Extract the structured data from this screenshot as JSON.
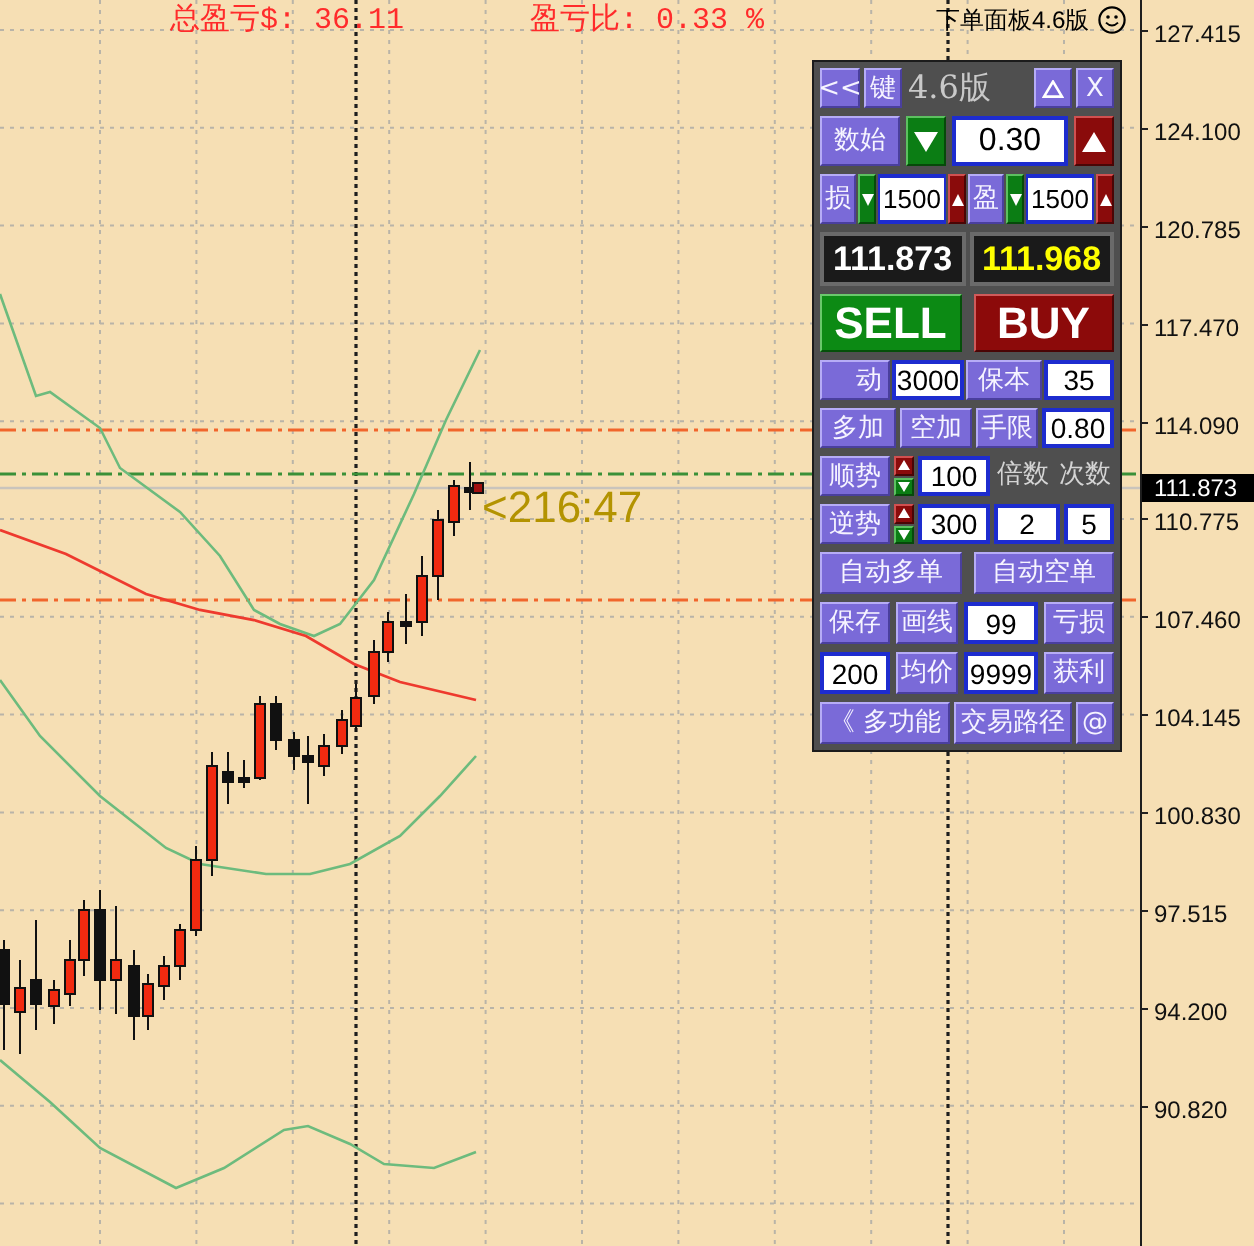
{
  "chart": {
    "stats": [
      "总盈亏$: 36.11",
      "盈亏比: 0.33 %"
    ],
    "caption": "下单面板4.6版",
    "trade_label": "<216:47"
  },
  "price_axis": {
    "ticks": [
      "127.415",
      "124.100",
      "120.785",
      "117.470",
      "114.090",
      "110.775",
      "107.460",
      "104.145",
      "100.830",
      "97.515",
      "94.200",
      "90.820"
    ],
    "current_price": "111.873"
  },
  "panel": {
    "title_bar": [
      {
        "kind": "button",
        "label": "<<"
      },
      {
        "kind": "button",
        "label": "键"
      },
      {
        "kind": "title",
        "text": "4.6版"
      },
      {
        "kind": "minimize"
      },
      {
        "kind": "close",
        "label": "X"
      }
    ],
    "row_1": [
      {
        "kind": "button",
        "label": "数始"
      },
      {
        "kind": "down"
      },
      {
        "kind": "field",
        "value": "0.30"
      },
      {
        "kind": "up"
      }
    ],
    "row_2": [
      {
        "kind": "button",
        "label": "损"
      },
      {
        "kind": "down"
      },
      {
        "kind": "field",
        "value": "1500"
      },
      {
        "kind": "up"
      },
      {
        "kind": "button",
        "label": "盈"
      },
      {
        "kind": "down"
      },
      {
        "kind": "field",
        "value": "1500"
      },
      {
        "kind": "up"
      }
    ],
    "row_3": [
      {
        "kind": "bid",
        "text": "111.873"
      },
      {
        "kind": "ask",
        "text": "111.968"
      }
    ],
    "row_4": [
      {
        "kind": "sell",
        "label": "SELL"
      },
      {
        "kind": "buy",
        "label": "BUY"
      }
    ],
    "row_5": [
      {
        "kind": "button",
        "label": "动"
      },
      {
        "kind": "field",
        "value": "3000"
      },
      {
        "kind": "button",
        "label": "保本"
      },
      {
        "kind": "field",
        "value": "35"
      }
    ],
    "row_6": [
      {
        "kind": "button",
        "label": "多加"
      },
      {
        "kind": "button",
        "label": "空加"
      },
      {
        "kind": "button",
        "label": "手限"
      },
      {
        "kind": "field",
        "value": "0.80"
      }
    ],
    "row_7": [
      {
        "kind": "button",
        "label": "顺势"
      },
      {
        "kind": "spinner"
      },
      {
        "kind": "field",
        "value": "100"
      },
      {
        "kind": "label",
        "text": "倍数"
      },
      {
        "kind": "label",
        "text": "次数"
      }
    ],
    "row_8": [
      {
        "kind": "button",
        "label": "逆势"
      },
      {
        "kind": "spinner"
      },
      {
        "kind": "field",
        "value": "300"
      },
      {
        "kind": "field",
        "value": "2"
      },
      {
        "kind": "field",
        "value": "5"
      }
    ],
    "row_9": [
      {
        "kind": "button",
        "label": "自动多单"
      },
      {
        "kind": "button",
        "label": "自动空单"
      }
    ],
    "row_10": [
      {
        "kind": "button",
        "label": "保存"
      },
      {
        "kind": "button",
        "label": "画线"
      },
      {
        "kind": "field",
        "value": "99"
      },
      {
        "kind": "button",
        "label": "亏损"
      }
    ],
    "row_11": [
      {
        "kind": "field",
        "value": "200"
      },
      {
        "kind": "button",
        "label": "均价"
      },
      {
        "kind": "field",
        "value": "9999"
      },
      {
        "kind": "button",
        "label": "获利"
      }
    ],
    "row_12": [
      {
        "kind": "button",
        "label": "《 多功能"
      },
      {
        "kind": "button",
        "label": "交易路径"
      },
      {
        "kind": "button",
        "label": "@"
      }
    ]
  }
}
